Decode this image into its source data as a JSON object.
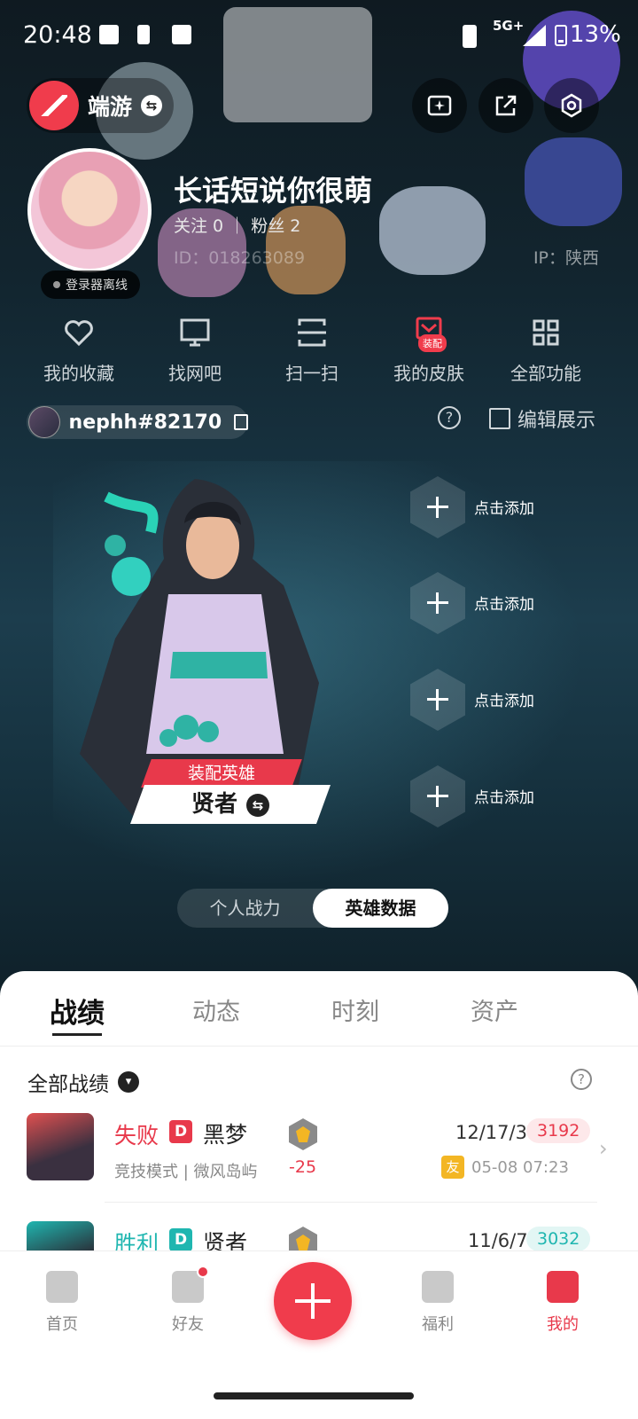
{
  "status_bar": {
    "time": "20:48",
    "network": "5G+",
    "battery": "13%"
  },
  "header": {
    "game_name": "端游"
  },
  "profile": {
    "nickname": "长话短说你很萌",
    "follow_text": "关注 0 ｜ 粉丝 2",
    "id_text": "ID：018263089",
    "ip_text": "IP：陕西",
    "login_status": "登录器离线"
  },
  "menu": [
    {
      "label": "我的收藏",
      "icon": "heart-icon"
    },
    {
      "label": "找网吧",
      "icon": "monitor-icon"
    },
    {
      "label": "扫一扫",
      "icon": "scan-icon"
    },
    {
      "label": "我的皮肤",
      "icon": "skin-icon",
      "badge": "装配"
    },
    {
      "label": "全部功能",
      "icon": "grid-icon"
    }
  ],
  "riot": {
    "id": "nephh#82170",
    "edit_label": "编辑展示"
  },
  "hero": {
    "equip_label": "装配英雄",
    "name": "贤者"
  },
  "add_slots": [
    "点击添加",
    "点击添加",
    "点击添加",
    "点击添加"
  ],
  "segment": {
    "items": [
      "个人战力",
      "英雄数据"
    ],
    "active_index": 1
  },
  "tabs": {
    "items": [
      "战绩",
      "动态",
      "时刻",
      "资产"
    ],
    "active_index": 0
  },
  "filter_label": "全部战绩",
  "matches": [
    {
      "result": "失败",
      "badge": "D",
      "map": "黑梦",
      "mode": "竞技模式 | 微风岛屿",
      "delta": "-25",
      "kda": "12/17/3",
      "score": "3192",
      "friend": "友",
      "time": "05-08 07:23"
    },
    {
      "result": "胜利",
      "badge": "D",
      "map": "贤者",
      "kda": "11/6/7",
      "score": "3032"
    }
  ],
  "colors": {
    "accent": "#f03c4c",
    "lose": "#e8394b",
    "win": "#1fb6b0"
  },
  "bottom_nav": [
    {
      "label": "首页",
      "icon": "home-icon"
    },
    {
      "label": "好友",
      "icon": "friends-icon"
    },
    {
      "label": "福利",
      "icon": "gift-icon"
    },
    {
      "label": "我的",
      "icon": "me-icon"
    }
  ]
}
